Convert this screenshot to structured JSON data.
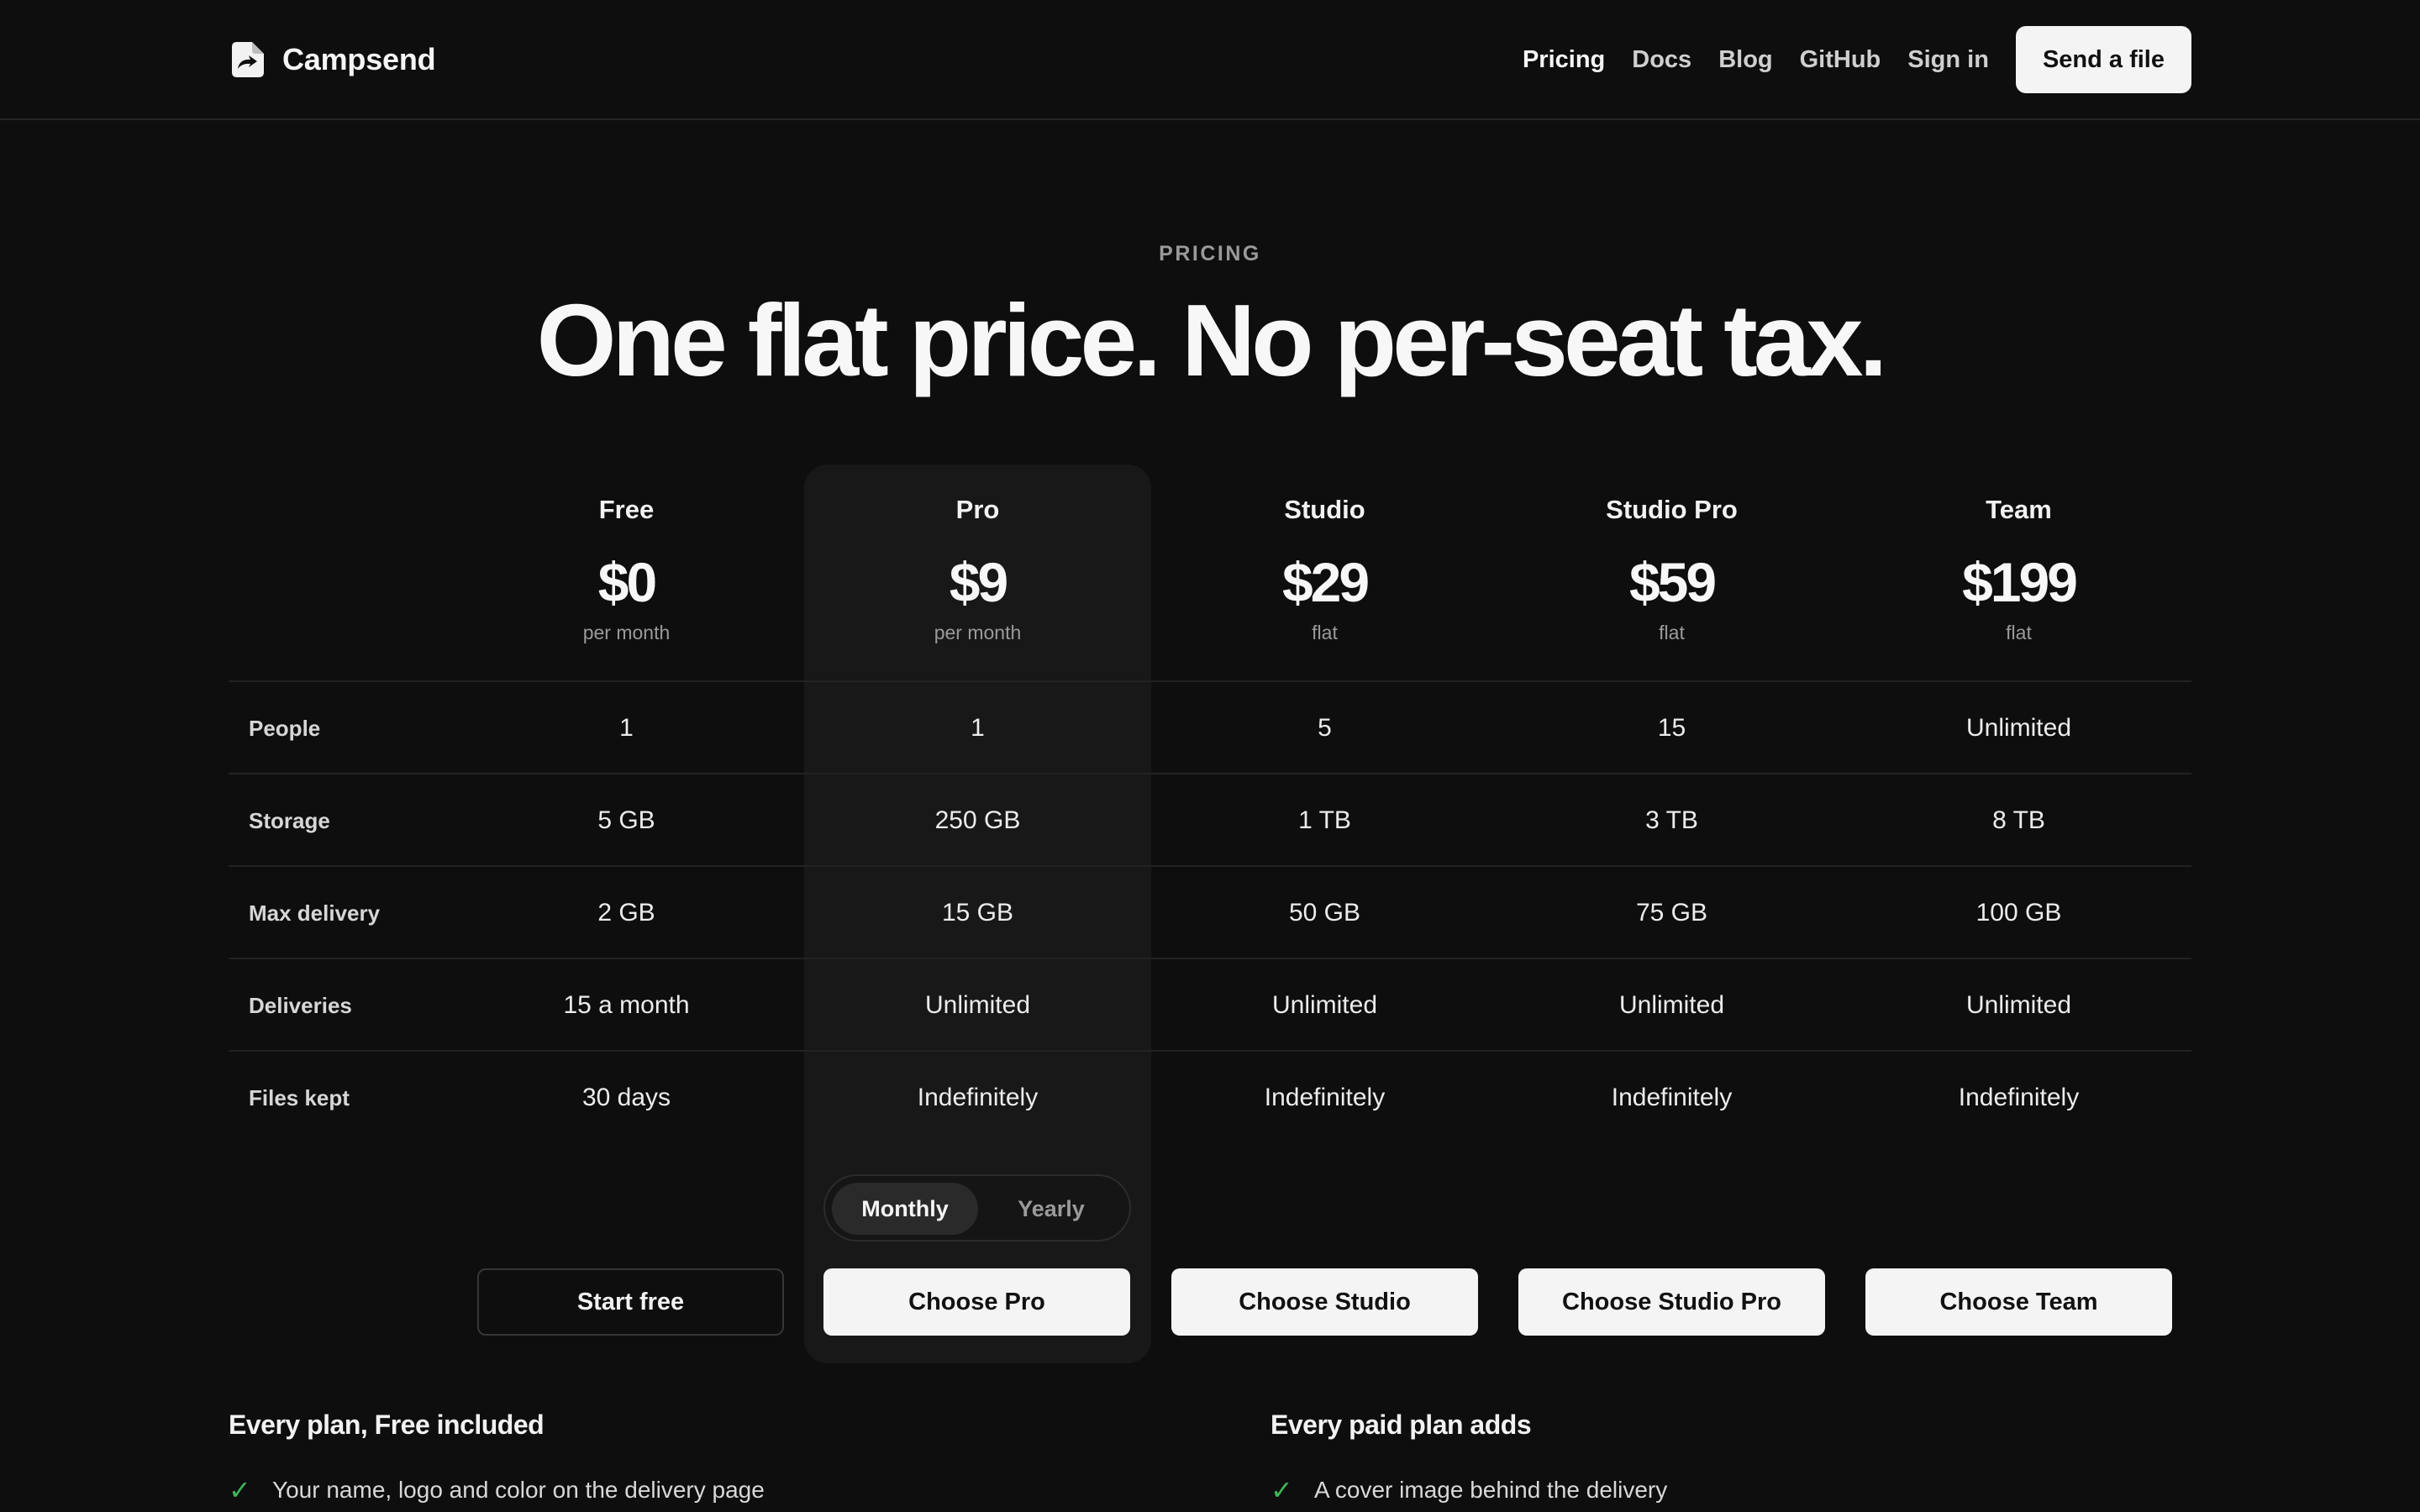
{
  "header": {
    "brand": "Campsend",
    "nav": [
      "Pricing",
      "Docs",
      "Blog",
      "GitHub",
      "Sign in"
    ],
    "cta": "Send a file"
  },
  "hero": {
    "eyebrow": "PRICING",
    "headline": "One flat price. No per-seat tax."
  },
  "plans": [
    {
      "name": "Free",
      "price": "$0",
      "period": "per month",
      "cta": "Start free"
    },
    {
      "name": "Pro",
      "price": "$9",
      "period": "per month",
      "cta": "Choose Pro"
    },
    {
      "name": "Studio",
      "price": "$29",
      "period": "flat",
      "cta": "Choose Studio"
    },
    {
      "name": "Studio Pro",
      "price": "$59",
      "period": "flat",
      "cta": "Choose Studio Pro"
    },
    {
      "name": "Team",
      "price": "$199",
      "period": "flat",
      "cta": "Choose Team"
    }
  ],
  "rows": [
    {
      "label": "People",
      "values": [
        "1",
        "1",
        "5",
        "15",
        "Unlimited"
      ]
    },
    {
      "label": "Storage",
      "values": [
        "5 GB",
        "250 GB",
        "1 TB",
        "3 TB",
        "8 TB"
      ]
    },
    {
      "label": "Max delivery",
      "values": [
        "2 GB",
        "15 GB",
        "50 GB",
        "75 GB",
        "100 GB"
      ]
    },
    {
      "label": "Deliveries",
      "values": [
        "15 a month",
        "Unlimited",
        "Unlimited",
        "Unlimited",
        "Unlimited"
      ]
    },
    {
      "label": "Files kept",
      "values": [
        "30 days",
        "Indefinitely",
        "Indefinitely",
        "Indefinitely",
        "Indefinitely"
      ]
    }
  ],
  "billing": {
    "monthly": "Monthly",
    "yearly": "Yearly",
    "selected": "Monthly"
  },
  "features": {
    "all": {
      "title": "Every plan, Free included",
      "items": [
        "Your name, logo and color on the delivery page"
      ]
    },
    "paid": {
      "title": "Every paid plan adds",
      "items": [
        "A cover image behind the delivery"
      ]
    }
  },
  "colors": {
    "background": "#0e0e0e",
    "highlight": "#181818",
    "check": "#3fb45a",
    "button": "#f4f4f4"
  }
}
